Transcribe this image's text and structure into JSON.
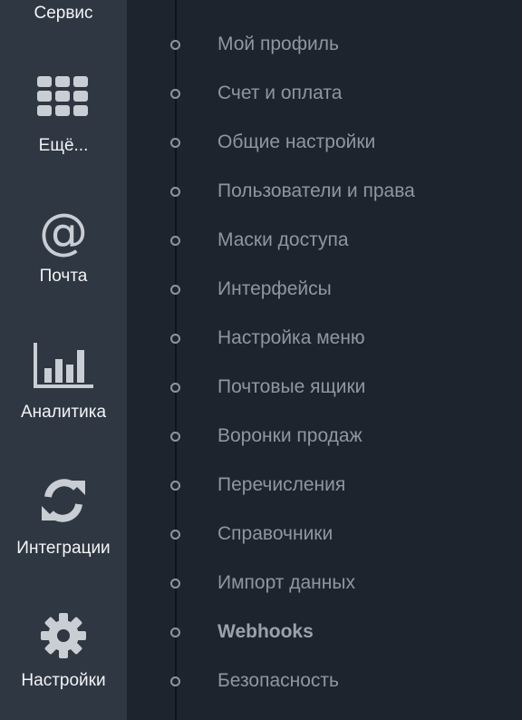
{
  "sidebar": {
    "items": [
      {
        "label": "Сервис",
        "icon": "service-icon"
      },
      {
        "label": "Ещё...",
        "icon": "grid-icon"
      },
      {
        "label": "Почта",
        "icon": "at-icon"
      },
      {
        "label": "Аналитика",
        "icon": "bar-chart-icon"
      },
      {
        "label": "Интеграции",
        "icon": "sync-icon"
      },
      {
        "label": "Настройки",
        "icon": "gear-icon"
      }
    ]
  },
  "settings_menu": {
    "items": [
      {
        "label": "Мой профиль"
      },
      {
        "label": "Счет и оплата"
      },
      {
        "label": "Общие настройки"
      },
      {
        "label": "Пользователи и права"
      },
      {
        "label": "Маски доступа"
      },
      {
        "label": "Интерфейсы"
      },
      {
        "label": "Настройка меню"
      },
      {
        "label": "Почтовые ящики"
      },
      {
        "label": "Воронки продаж"
      },
      {
        "label": "Перечисления"
      },
      {
        "label": "Справочники"
      },
      {
        "label": "Импорт данных"
      },
      {
        "label": "Webhooks",
        "emphasis": "bold"
      },
      {
        "label": "Безопасность"
      }
    ]
  },
  "colors": {
    "sidebar_bg": "#2f3742",
    "content_bg": "#1d242d",
    "icon": "#c9ced4",
    "menu_text": "#8e97a1"
  }
}
